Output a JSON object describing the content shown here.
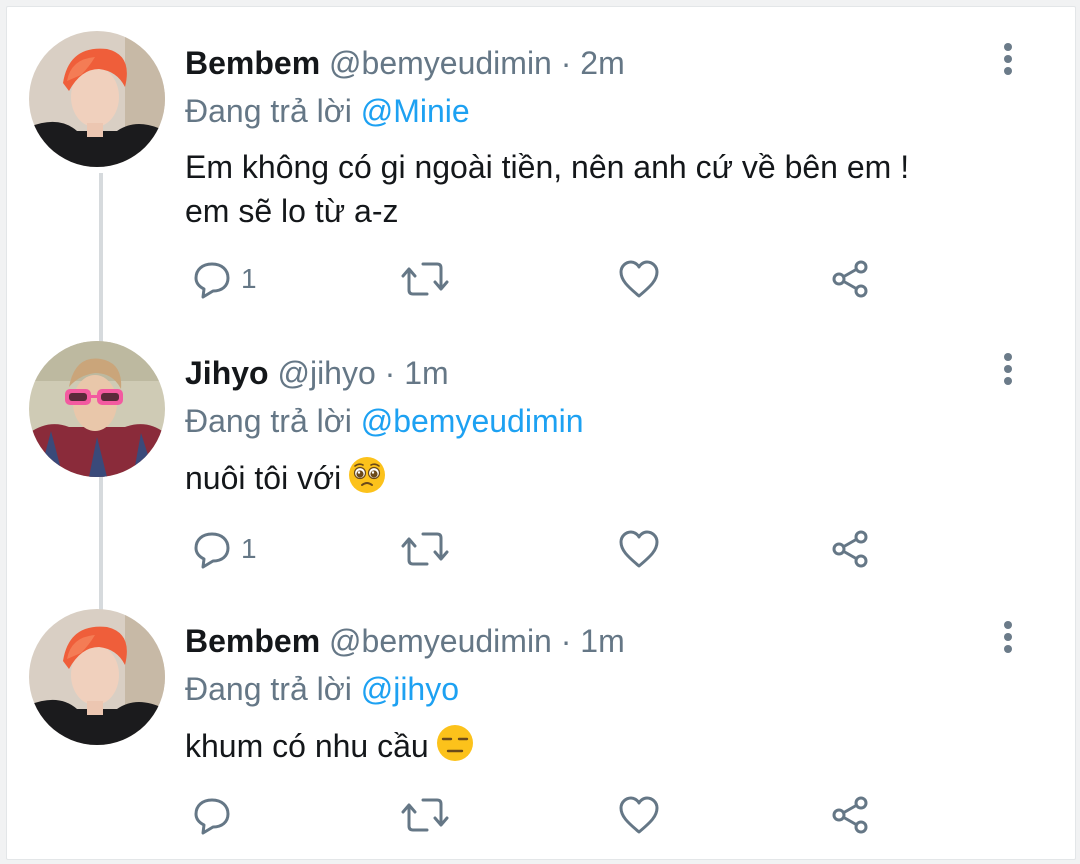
{
  "tweets": [
    {
      "name": "Bembem",
      "handle": "@bemyeudimin",
      "dot": "·",
      "time": "2m",
      "reply_prefix": "Đang trả lời",
      "reply_to": "@Minie",
      "text_line1": "Em không có gi ngoài tiền, nên anh cứ về bên em !",
      "text_line2": "em sẽ lo từ a-z",
      "reply_count": "1",
      "emoji": ""
    },
    {
      "name": "Jihyo",
      "handle": "@jihyo",
      "dot": "·",
      "time": "1m",
      "reply_prefix": "Đang trả lời",
      "reply_to": "@bemyeudimin",
      "text_line1": "nuôi tôi với",
      "text_line2": "",
      "reply_count": "1",
      "emoji": "pleading-face"
    },
    {
      "name": "Bembem",
      "handle": "@bemyeudimin",
      "dot": "·",
      "time": "1m",
      "reply_prefix": "Đang trả lời",
      "reply_to": "@jihyo",
      "text_line1": "khum có nhu cầu",
      "text_line2": "",
      "reply_count": "",
      "emoji": "expressionless-face"
    }
  ],
  "icons": {
    "reply": "reply-icon",
    "retweet": "retweet-icon",
    "like": "heart-icon",
    "share": "share-icon",
    "more": "more-vertical-icon"
  },
  "colors": {
    "mention": "#1da1f2",
    "secondary_text": "#657786",
    "thread_line": "#d6dadd"
  }
}
